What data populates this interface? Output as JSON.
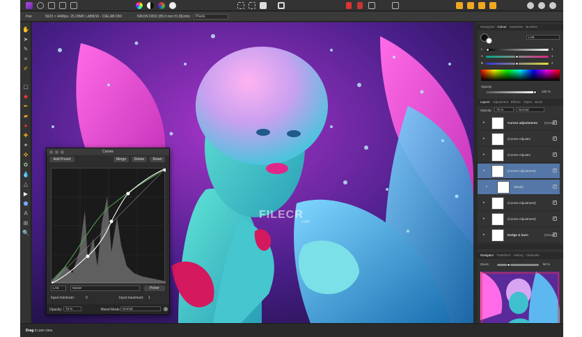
{
  "context_bar": {
    "tool": "Pan",
    "doc_info": "5623 × 4498px, 25.29MP, LAB8/16 - CIELAB D50",
    "camera": "NIKON D810 (85.0 mm f/1.8)",
    "units_label": "Units:",
    "units_value": "Pixels"
  },
  "color_panel": {
    "tabs": [
      "Histogram",
      "Colour",
      "Swatches",
      "Brushes"
    ],
    "active_tab": "Colour",
    "model": "LAB",
    "channels": [
      {
        "name": "L",
        "value": "1"
      },
      {
        "name": "A",
        "value": "1"
      },
      {
        "name": "B",
        "value": "2"
      }
    ],
    "opacity_label": "Opacity",
    "opacity_value": "100 %"
  },
  "layers_panel": {
    "tabs": [
      "Layers",
      "Adjustment",
      "Effects",
      "Styles",
      "Stock"
    ],
    "active_tab": "Layers",
    "opacity_label": "Opacity:",
    "opacity_value": "75 %",
    "blend": "Normal",
    "layers": [
      {
        "name": "Curves adjustments",
        "suffix": "(Group)",
        "bold": true,
        "selected": false
      },
      {
        "name": "(Curves Adjustm",
        "suffix": "",
        "bold": false,
        "selected": false
      },
      {
        "name": "(Curves Adjustm",
        "suffix": "",
        "bold": false,
        "selected": false
      },
      {
        "name": "(Curves Adjustment)",
        "suffix": "",
        "bold": false,
        "selected": true
      },
      {
        "name": "(Mask)",
        "suffix": "",
        "bold": false,
        "selected": true
      },
      {
        "name": "(Curves Adjustment)",
        "suffix": "",
        "bold": false,
        "selected": false
      },
      {
        "name": "(Curves Adjustment)",
        "suffix": "",
        "bold": false,
        "selected": false
      },
      {
        "name": "Dodge & burn",
        "suffix": "(Group)",
        "bold": true,
        "selected": false
      }
    ]
  },
  "navigator_panel": {
    "tabs": [
      "Navigator",
      "Transform",
      "History",
      "Channels"
    ],
    "active_tab": "Navigator",
    "zoom_label": "Zoom:",
    "zoom_value": "50 %"
  },
  "curves_dialog": {
    "title": "Curves",
    "add_preset": "Add Preset",
    "merge": "Merge",
    "delete": "Delete",
    "reset": "Reset",
    "colour_space": "LAB",
    "channel": "Master",
    "picker": "Picker",
    "input_min_label": "Input minimum:",
    "input_min_value": "0",
    "input_max_label": "Input maximum:",
    "input_max_value": "1",
    "opacity_label": "Opacity:",
    "opacity_value": "75 %",
    "blend_label": "Blend Mode:",
    "blend_value": "Normal"
  },
  "watermark": {
    "text": "FILECR",
    "sub": ".com"
  },
  "status": {
    "bold": "Drag",
    "text": " to pan view."
  }
}
